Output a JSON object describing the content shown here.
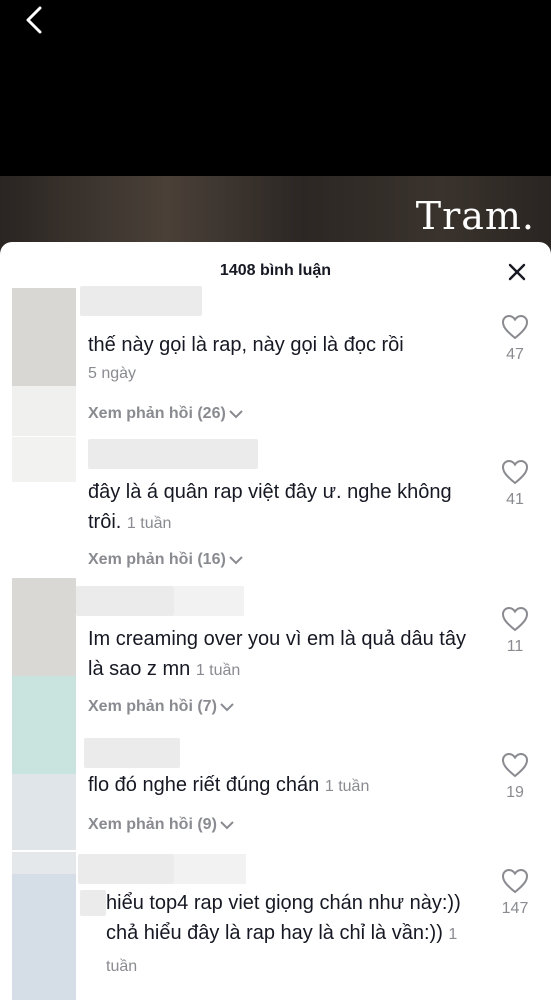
{
  "video": {
    "watermark": "Tram."
  },
  "sheet": {
    "title": "1408 bình luận"
  },
  "comments": [
    {
      "text": "thế này gọi là rap, này gọi là đọc rồi",
      "time": "5 ngày",
      "replies": "Xem phản hồi (26)",
      "likes": "47"
    },
    {
      "text": "đây là á quân rap việt đây ư. nghe không trôi.",
      "time": "1 tuần",
      "replies": "Xem phản hồi (16)",
      "likes": "41"
    },
    {
      "text": "Im creaming over you vì em là quả dâu tây là sao z mn",
      "time": "1 tuần",
      "replies": "Xem phản hồi (7)",
      "likes": "11"
    },
    {
      "text": "flo đó nghe riết đúng chán",
      "time": "1 tuần",
      "replies": "Xem phản hồi (9)",
      "likes": "19"
    },
    {
      "text": "hiểu top4 rap viet giọng chán như này:)) chả hiểu đây là rap hay là chỉ là vần:))",
      "time": "1 tuần",
      "likes": "147"
    }
  ],
  "icons": {
    "back": "chevron-left-icon",
    "close": "close-icon",
    "like": "heart-outline-icon",
    "expand": "chevron-down-icon"
  }
}
